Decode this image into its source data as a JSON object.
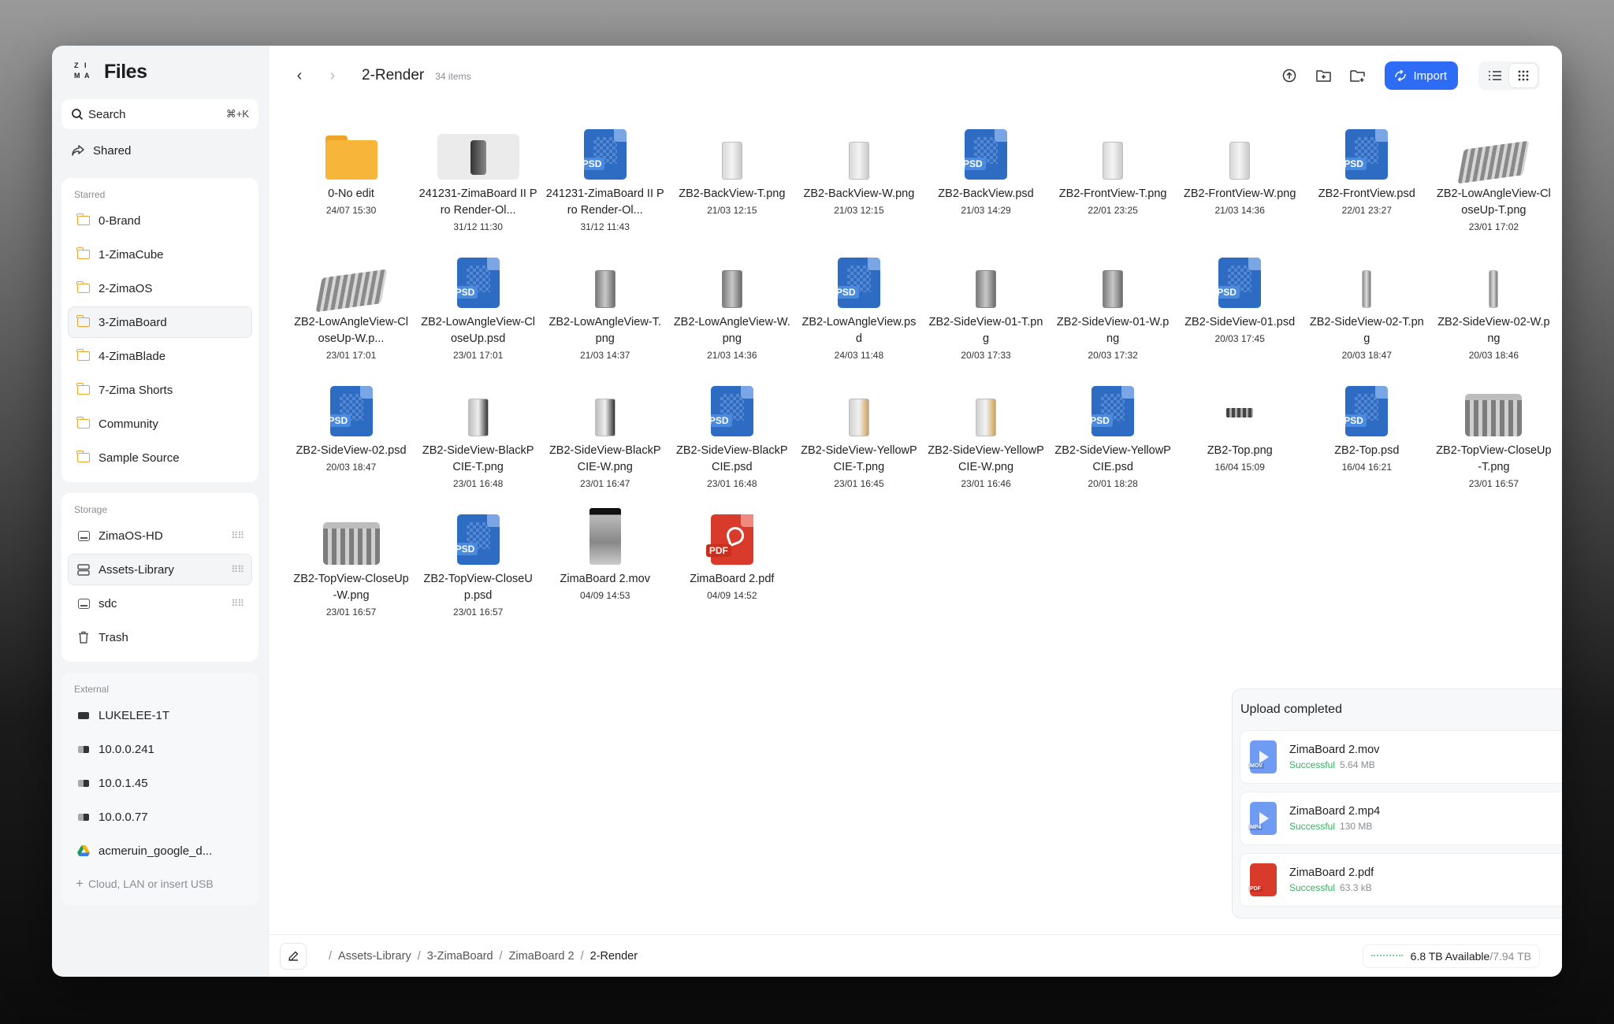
{
  "app": {
    "title": "Files",
    "logo": "ZIMA"
  },
  "search": {
    "label": "Search",
    "shortcut": "⌘+K"
  },
  "shared": {
    "label": "Shared"
  },
  "starred": {
    "label": "Starred",
    "items": [
      {
        "label": "0-Brand",
        "active": false
      },
      {
        "label": "1-ZimaCube",
        "active": false
      },
      {
        "label": "2-ZimaOS",
        "active": false
      },
      {
        "label": "3-ZimaBoard",
        "active": true
      },
      {
        "label": "4-ZimaBlade",
        "active": false
      },
      {
        "label": "7-Zima Shorts",
        "active": false
      },
      {
        "label": "Community",
        "active": false
      },
      {
        "label": "Sample Source",
        "active": false
      }
    ]
  },
  "storage": {
    "label": "Storage",
    "items": [
      {
        "label": "ZimaOS-HD",
        "icon": "disk-icon"
      },
      {
        "label": "Assets-Library",
        "icon": "server-icon"
      },
      {
        "label": "sdc",
        "icon": "disk-icon"
      },
      {
        "label": "Trash",
        "icon": "trash-icon"
      }
    ]
  },
  "external": {
    "label": "External",
    "items": [
      {
        "label": "LUKELEE-1T",
        "icon": "usb-drive-icon"
      },
      {
        "label": "10.0.0.241",
        "icon": "network-drive-icon"
      },
      {
        "label": "10.0.1.45",
        "icon": "network-drive-icon"
      },
      {
        "label": "10.0.0.77",
        "icon": "network-drive-icon"
      },
      {
        "label": "acmeruin_google_d...",
        "icon": "google-drive-icon"
      }
    ],
    "add_label": "Cloud, LAN or insert USB"
  },
  "toolbar": {
    "title": "2-Render",
    "count": "34 items",
    "import_label": "Import"
  },
  "files": [
    {
      "name": "0-No edit",
      "date": "24/07 15:30",
      "type": "folder"
    },
    {
      "name": "241231-ZimaBoard II Pro Render-Ol...",
      "date": "31/12 11:30",
      "type": "photo"
    },
    {
      "name": "241231-ZimaBoard II Pro Render-Ol...",
      "date": "31/12 11:43",
      "type": "psd"
    },
    {
      "name": "ZB2-BackView-T.png",
      "date": "21/03 12:15",
      "type": "slim"
    },
    {
      "name": "ZB2-BackView-W.png",
      "date": "21/03 12:15",
      "type": "slim"
    },
    {
      "name": "ZB2-BackView.psd",
      "date": "21/03 14:29",
      "type": "psd"
    },
    {
      "name": "ZB2-FrontView-T.png",
      "date": "22/01 23:25",
      "type": "slim"
    },
    {
      "name": "ZB2-FrontView-W.png",
      "date": "21/03 14:36",
      "type": "slim"
    },
    {
      "name": "ZB2-FrontView.psd",
      "date": "22/01 23:27",
      "type": "psd"
    },
    {
      "name": "ZB2-LowAngleView-CloseUp-T.png",
      "date": "23/01 17:02",
      "type": "angle"
    },
    {
      "name": "ZB2-LowAngleView-CloseUp-W.p...",
      "date": "23/01 17:01",
      "type": "angle"
    },
    {
      "name": "ZB2-LowAngleView-CloseUp.psd",
      "date": "23/01 17:01",
      "type": "psd"
    },
    {
      "name": "ZB2-LowAngleView-T.png",
      "date": "21/03 14:37",
      "type": "slim-dark"
    },
    {
      "name": "ZB2-LowAngleView-W.png",
      "date": "21/03 14:36",
      "type": "slim-dark"
    },
    {
      "name": "ZB2-LowAngleView.psd",
      "date": "24/03 11:48",
      "type": "psd"
    },
    {
      "name": "ZB2-SideView-01-T.png",
      "date": "20/03 17:33",
      "type": "slim-dark"
    },
    {
      "name": "ZB2-SideView-01-W.png",
      "date": "20/03 17:32",
      "type": "slim-dark"
    },
    {
      "name": "ZB2-SideView-01.psd",
      "date": "20/03 17:45",
      "type": "psd"
    },
    {
      "name": "ZB2-SideView-02-T.png",
      "date": "20/03 18:47",
      "type": "slim-thin"
    },
    {
      "name": "ZB2-SideView-02-W.png",
      "date": "20/03 18:46",
      "type": "slim-thin"
    },
    {
      "name": "ZB2-SideView-02.psd",
      "date": "20/03 18:47",
      "type": "psd"
    },
    {
      "name": "ZB2-SideView-BlackPCIE-T.png",
      "date": "23/01 16:48",
      "type": "slim-black"
    },
    {
      "name": "ZB2-SideView-BlackPCIE-W.png",
      "date": "23/01 16:47",
      "type": "slim-black"
    },
    {
      "name": "ZB2-SideView-BlackPCIE.psd",
      "date": "23/01 16:48",
      "type": "psd"
    },
    {
      "name": "ZB2-SideView-YellowPCIE-T.png",
      "date": "23/01 16:45",
      "type": "slim-yellow"
    },
    {
      "name": "ZB2-SideView-YellowPCIE-W.png",
      "date": "23/01 16:46",
      "type": "slim-yellow"
    },
    {
      "name": "ZB2-SideView-YellowPCIE.psd",
      "date": "20/01 18:28",
      "type": "psd"
    },
    {
      "name": "ZB2-Top.png",
      "date": "16/04 15:09",
      "type": "top"
    },
    {
      "name": "ZB2-Top.psd",
      "date": "16/04 16:21",
      "type": "psd"
    },
    {
      "name": "ZB2-TopView-CloseUp-T.png",
      "date": "23/01 16:57",
      "type": "box"
    },
    {
      "name": "ZB2-TopView-CloseUp-W.png",
      "date": "23/01 16:57",
      "type": "box"
    },
    {
      "name": "ZB2-TopView-CloseUp.psd",
      "date": "23/01 16:57",
      "type": "psd"
    },
    {
      "name": "ZimaBoard 2.mov",
      "date": "04/09 14:53",
      "type": "mov"
    },
    {
      "name": "ZimaBoard 2.pdf",
      "date": "04/09 14:52",
      "type": "pdf"
    }
  ],
  "upload": {
    "title": "Upload completed",
    "items": [
      {
        "name": "ZimaBoard 2.mov",
        "status": "Successful",
        "size": "5.64 MB",
        "kind": "MOV"
      },
      {
        "name": "ZimaBoard 2.mp4",
        "status": "Successful",
        "size": "130 MB",
        "kind": "MP4"
      },
      {
        "name": "ZimaBoard 2.pdf",
        "status": "Successful",
        "size": "63.3 kB",
        "kind": "PDF"
      }
    ]
  },
  "breadcrumb": [
    "Assets-Library",
    "3-ZimaBoard",
    "ZimaBoard 2",
    "2-Render"
  ],
  "disk": {
    "available": "6.8 TB Available",
    "total": "/7.94 TB"
  },
  "colors": {
    "accent": "#2f6cf5",
    "folder": "#f7b63a",
    "psd": "#2e6cc4",
    "pdf": "#d83b2b",
    "success": "#2fb45c"
  }
}
